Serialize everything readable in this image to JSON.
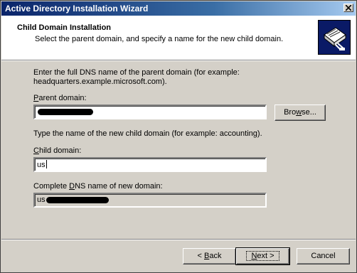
{
  "window": {
    "title": "Active Directory Installation Wizard"
  },
  "header": {
    "title": "Child Domain Installation",
    "subtitle": "Select the parent domain, and specify a name for the new child domain."
  },
  "instructions": {
    "parent_line1": "Enter the full DNS name of the parent domain (for example:",
    "parent_line2": "headquarters.example.microsoft.com).",
    "child": "Type the name of the new child domain (for example: accounting)."
  },
  "parent_domain": {
    "label_accel": "P",
    "label_rest": "arent domain:",
    "value": ""
  },
  "browse_button": {
    "label_accel": "w",
    "label_pre": "Bro",
    "label_post": "se..."
  },
  "child_domain": {
    "label_accel": "C",
    "label_rest": "hild domain:",
    "value": "us"
  },
  "complete_dns": {
    "label_pre": "Complete ",
    "label_accel": "D",
    "label_post": "NS name of new domain:",
    "value_prefix": "us"
  },
  "buttons": {
    "back_pre": "< ",
    "back_accel": "B",
    "back_post": "ack",
    "next_accel": "N",
    "next_post": "ext >",
    "cancel": "Cancel"
  },
  "icons": {
    "wizard": "domain-book-icon",
    "close": "close-icon"
  }
}
